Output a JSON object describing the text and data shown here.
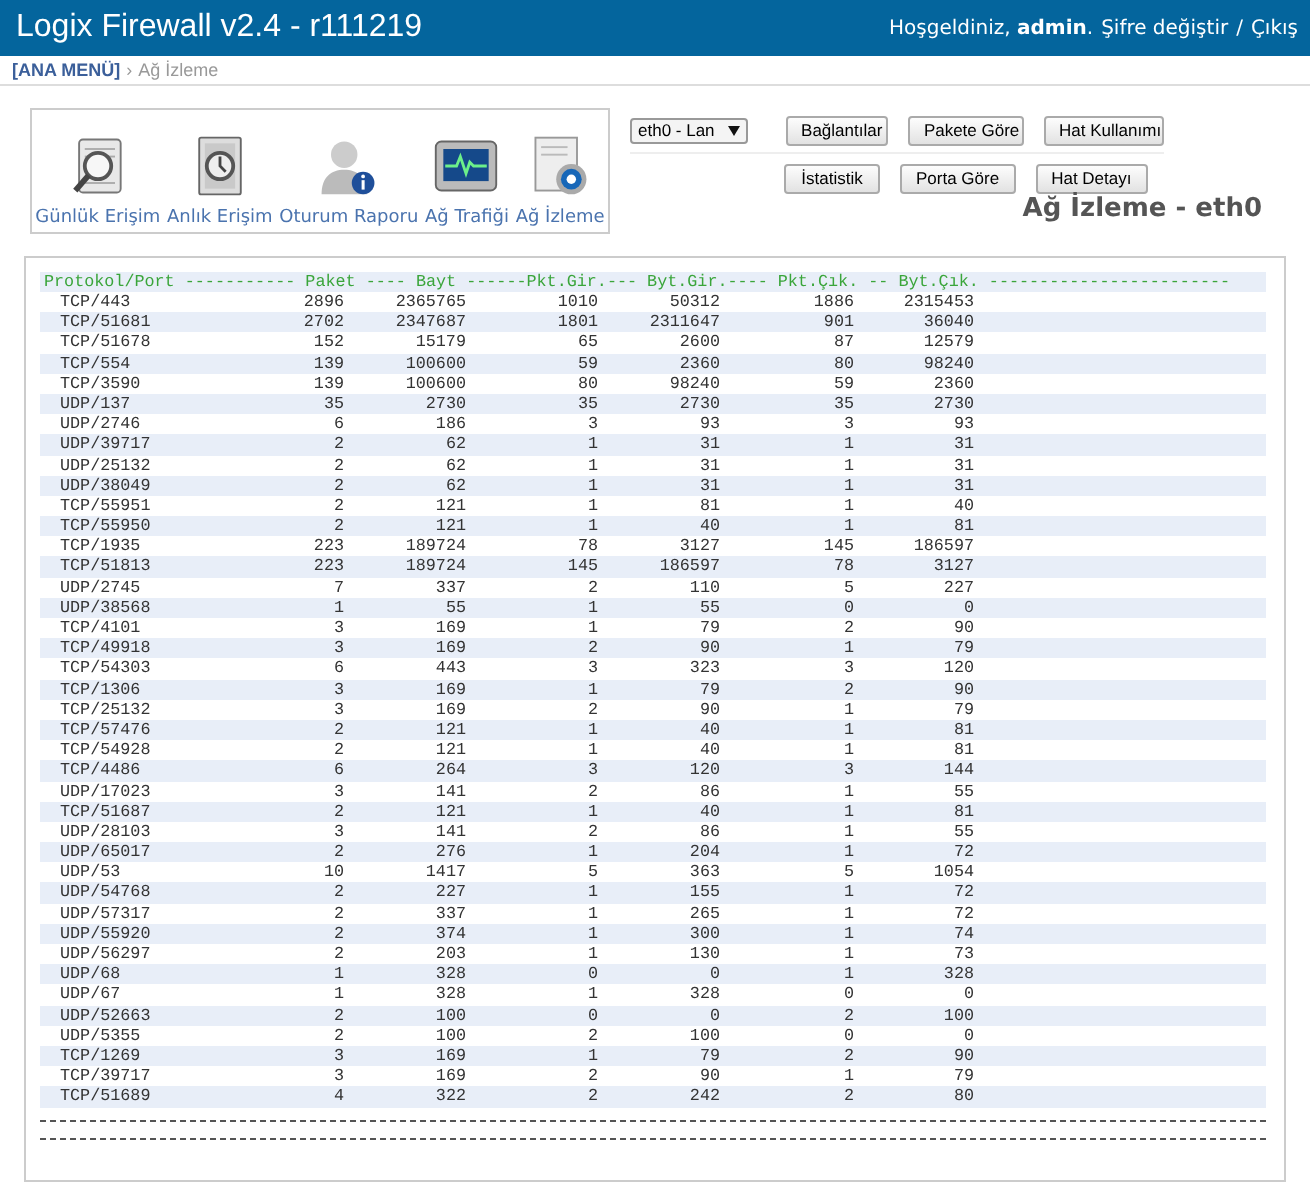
{
  "header": {
    "title": "Logix Firewall v2.4 - r111219",
    "greeting": "Hoşgeldiniz, **admin**.",
    "links": [
      "Şifre değiştir",
      "Çıkış"
    ],
    "separator": "/"
  },
  "breadcrumb": {
    "root": "[ANA MENÜ]",
    "separator": "›",
    "current": "Ağ İzleme"
  },
  "menu": [
    {
      "label": "Günlük Erişim"
    },
    {
      "label": "Anlık Erişim"
    },
    {
      "label": "Oturum Raporu"
    },
    {
      "label": "Ağ Trafiği"
    },
    {
      "label": "Ağ İzleme"
    }
  ],
  "interface_select": {
    "value": "eth0 - Lan"
  },
  "buttons_row_1": [
    "Bağlantılar",
    "Pakete Göre",
    "Hat Kullanımı"
  ],
  "buttons_row_2": [
    "İstatistik",
    "Porta Göre",
    "Hat Detayı"
  ],
  "page_title": "Ağ İzleme - eth0",
  "report": {
    "header": "Protokol/Port ----------- Paket ---- Bayt ------Pkt.Gir.--- Byt.Gir.---- Pkt.Çık. -- Byt.Çık. ------------------------",
    "rows": [
      [
        "TCP/443",
        "2896",
        "2365765",
        "1010",
        "50312",
        "1886",
        "2315453"
      ],
      [
        "TCP/51681",
        "2702",
        "2347687",
        "1801",
        "2311647",
        "901",
        "36040"
      ],
      [
        "TCP/51678",
        "152",
        "15179",
        "65",
        "2600",
        "87",
        "12579"
      ],
      [
        "TCP/554",
        "139",
        "100600",
        "59",
        "2360",
        "80",
        "98240"
      ],
      [
        "TCP/3590",
        "139",
        "100600",
        "80",
        "98240",
        "59",
        "2360"
      ],
      [
        "UDP/137",
        "35",
        "2730",
        "35",
        "2730",
        "35",
        "2730"
      ],
      [
        "UDP/2746",
        "6",
        "186",
        "3",
        "93",
        "3",
        "93"
      ],
      [
        "UDP/39717",
        "2",
        "62",
        "1",
        "31",
        "1",
        "31"
      ],
      [
        "UDP/25132",
        "2",
        "62",
        "1",
        "31",
        "1",
        "31"
      ],
      [
        "UDP/38049",
        "2",
        "62",
        "1",
        "31",
        "1",
        "31"
      ],
      [
        "TCP/55951",
        "2",
        "121",
        "1",
        "81",
        "1",
        "40"
      ],
      [
        "TCP/55950",
        "2",
        "121",
        "1",
        "40",
        "1",
        "81"
      ],
      [
        "TCP/1935",
        "223",
        "189724",
        "78",
        "3127",
        "145",
        "186597"
      ],
      [
        "TCP/51813",
        "223",
        "189724",
        "145",
        "186597",
        "78",
        "3127"
      ],
      [
        "UDP/2745",
        "7",
        "337",
        "2",
        "110",
        "5",
        "227"
      ],
      [
        "UDP/38568",
        "1",
        "55",
        "1",
        "55",
        "0",
        "0"
      ],
      [
        "TCP/4101",
        "3",
        "169",
        "1",
        "79",
        "2",
        "90"
      ],
      [
        "TCP/49918",
        "3",
        "169",
        "2",
        "90",
        "1",
        "79"
      ],
      [
        "TCP/54303",
        "6",
        "443",
        "3",
        "323",
        "3",
        "120"
      ],
      [
        "TCP/1306",
        "3",
        "169",
        "1",
        "79",
        "2",
        "90"
      ],
      [
        "TCP/25132",
        "3",
        "169",
        "2",
        "90",
        "1",
        "79"
      ],
      [
        "TCP/57476",
        "2",
        "121",
        "1",
        "40",
        "1",
        "81"
      ],
      [
        "TCP/54928",
        "2",
        "121",
        "1",
        "40",
        "1",
        "81"
      ],
      [
        "TCP/4486",
        "6",
        "264",
        "3",
        "120",
        "3",
        "144"
      ],
      [
        "UDP/17023",
        "3",
        "141",
        "2",
        "86",
        "1",
        "55"
      ],
      [
        "TCP/51687",
        "2",
        "121",
        "1",
        "40",
        "1",
        "81"
      ],
      [
        "UDP/28103",
        "3",
        "141",
        "2",
        "86",
        "1",
        "55"
      ],
      [
        "UDP/65017",
        "2",
        "276",
        "1",
        "204",
        "1",
        "72"
      ],
      [
        "UDP/53",
        "10",
        "1417",
        "5",
        "363",
        "5",
        "1054"
      ],
      [
        "UDP/54768",
        "2",
        "227",
        "1",
        "155",
        "1",
        "72"
      ],
      [
        "UDP/57317",
        "2",
        "337",
        "1",
        "265",
        "1",
        "72"
      ],
      [
        "UDP/55920",
        "2",
        "374",
        "1",
        "300",
        "1",
        "74"
      ],
      [
        "UDP/56297",
        "2",
        "203",
        "1",
        "130",
        "1",
        "73"
      ],
      [
        "UDP/68",
        "1",
        "328",
        "0",
        "0",
        "1",
        "328"
      ],
      [
        "UDP/67",
        "1",
        "328",
        "1",
        "328",
        "0",
        "0"
      ],
      [
        "UDP/52663",
        "2",
        "100",
        "0",
        "0",
        "2",
        "100"
      ],
      [
        "UDP/5355",
        "2",
        "100",
        "2",
        "100",
        "0",
        "0"
      ],
      [
        "TCP/1269",
        "3",
        "169",
        "1",
        "79",
        "2",
        "90"
      ],
      [
        "TCP/39717",
        "3",
        "169",
        "2",
        "90",
        "1",
        "79"
      ],
      [
        "TCP/51689",
        "4",
        "322",
        "2",
        "242",
        "2",
        "80"
      ]
    ]
  }
}
